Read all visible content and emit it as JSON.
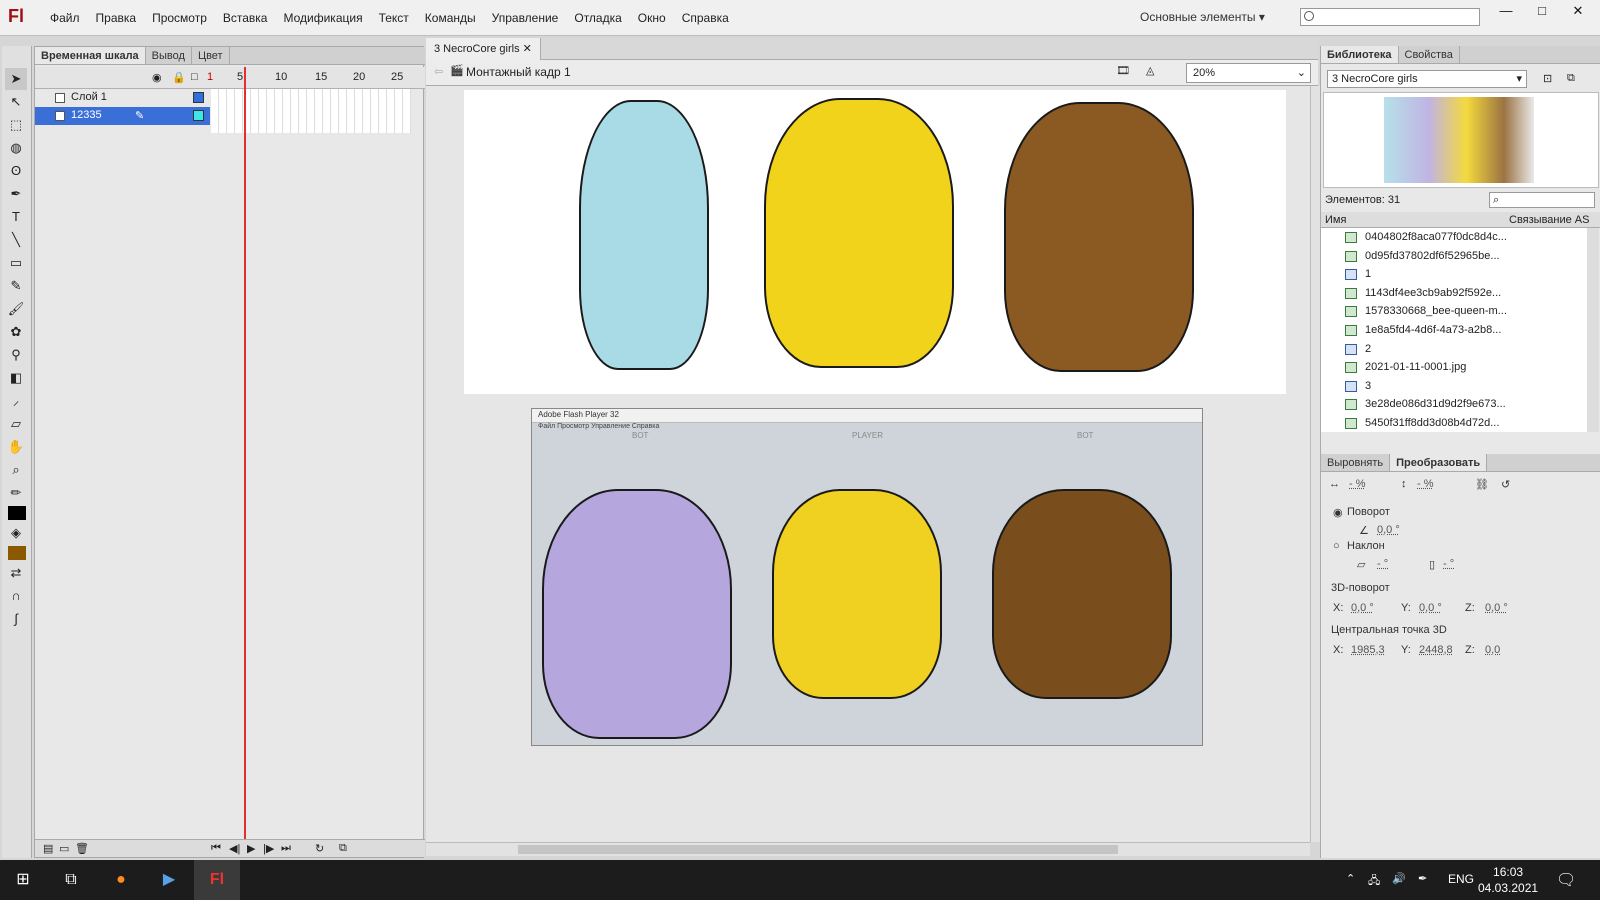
{
  "app": {
    "logo": "Fl",
    "workspace": "Основные элементы"
  },
  "menu": [
    "Файл",
    "Правка",
    "Просмотр",
    "Вставка",
    "Модификация",
    "Текст",
    "Команды",
    "Управление",
    "Отладка",
    "Окно",
    "Справка"
  ],
  "timeline_panel": {
    "tabs": [
      "Временная шкала",
      "Вывод",
      "Цвет"
    ],
    "ruler": [
      "1",
      "5",
      "10",
      "15",
      "20",
      "25"
    ],
    "layers": [
      {
        "name": "Слой 1"
      },
      {
        "name": "12335"
      }
    ]
  },
  "document": {
    "tab": "3 NecroCore girls",
    "scene": "Монтажный кадр 1",
    "zoom": "20%"
  },
  "player": {
    "title": "Adobe Flash Player 32",
    "menu": "Файл  Просмотр  Управление  Справка",
    "labels": [
      "BOT",
      "PLAYER",
      "BOT"
    ]
  },
  "library": {
    "tabs": [
      "Библиотека",
      "Свойства"
    ],
    "selected_doc": "3 NecroCore girls",
    "count_label": "Элементов: 31",
    "col_name": "Имя",
    "col_link": "Связывание AS",
    "items": [
      {
        "name": "0404802f8aca077f0dc8d4c...",
        "type": "bitmap"
      },
      {
        "name": "0d95fd37802df6f52965be...",
        "type": "bitmap"
      },
      {
        "name": "1",
        "type": "symbol"
      },
      {
        "name": "1143df4ee3cb9ab92f592e...",
        "type": "bitmap"
      },
      {
        "name": "1578330668_bee-queen-m...",
        "type": "bitmap"
      },
      {
        "name": "1e8a5fd4-4d6f-4a73-a2b8...",
        "type": "bitmap"
      },
      {
        "name": "2",
        "type": "symbol"
      },
      {
        "name": "2021-01-11-0001.jpg",
        "type": "bitmap"
      },
      {
        "name": "3",
        "type": "symbol"
      },
      {
        "name": "3e28de086d31d9d2f9e673...",
        "type": "bitmap"
      },
      {
        "name": "5450f31ff8dd3d08b4d72d...",
        "type": "bitmap"
      }
    ]
  },
  "transform": {
    "tabs": [
      "Выровнять",
      "Преобразовать"
    ],
    "width_pct": "- %",
    "height_pct": "- %",
    "rotate_label": "Поворот",
    "rotate_val": "0,0 °",
    "skew_label": "Наклон",
    "skew_x": "- °",
    "skew_y": "- °",
    "rot3d_label": "3D-поворот",
    "rx": "0,0 °",
    "ry": "0,0 °",
    "rz": "0,0 °",
    "center3d_label": "Центральная точка 3D",
    "cx": "1985,3",
    "cy": "2448,8",
    "cz": "0,0",
    "x_label": "X:",
    "y_label": "Y:",
    "z_label": "Z:"
  },
  "taskbar": {
    "lang": "ENG",
    "time": "16:03",
    "date": "04.03.2021"
  }
}
